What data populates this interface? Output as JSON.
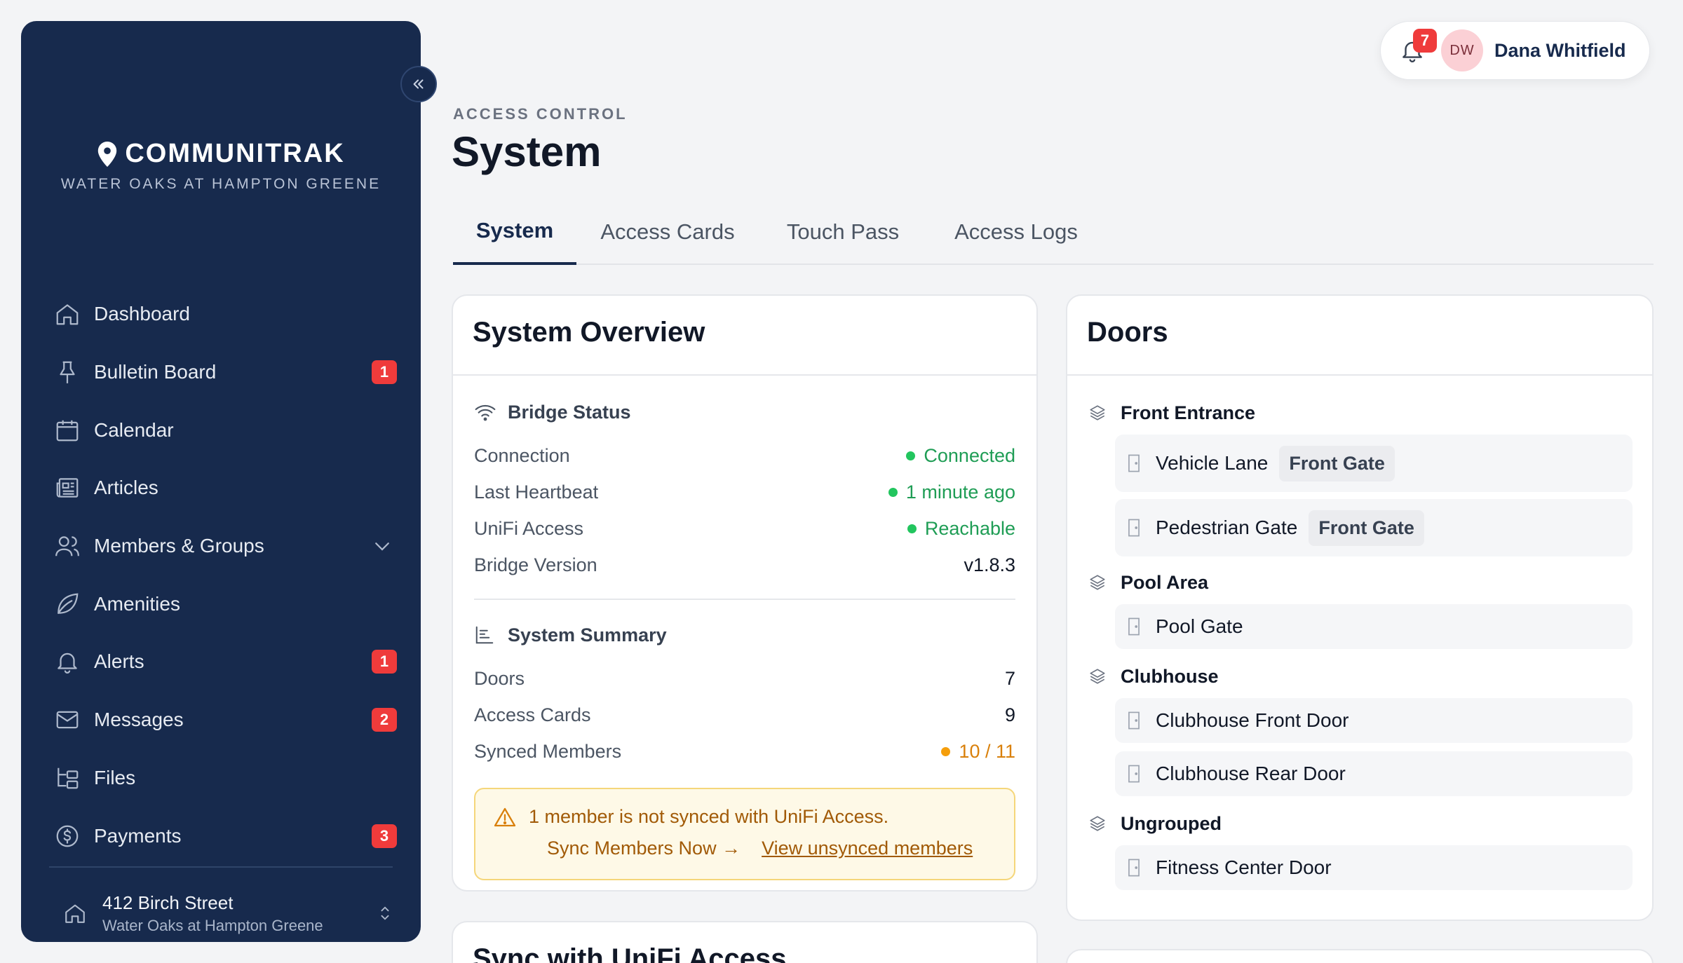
{
  "sidebar": {
    "brand_name": "COMMUNITRAK",
    "brand_subtitle": "WATER OAKS AT HAMPTON GREENE",
    "items": [
      {
        "label": "Dashboard",
        "icon": "home-icon"
      },
      {
        "label": "Bulletin Board",
        "icon": "pushpin-icon",
        "badge": "1"
      },
      {
        "label": "Calendar",
        "icon": "calendar-icon"
      },
      {
        "label": "Articles",
        "icon": "newspaper-icon"
      },
      {
        "label": "Members & Groups",
        "icon": "users-icon"
      },
      {
        "label": "Amenities",
        "icon": "leaf-icon"
      },
      {
        "label": "Alerts",
        "icon": "bell-icon",
        "badge": "1"
      },
      {
        "label": "Messages",
        "icon": "mail-icon",
        "badge": "2"
      },
      {
        "label": "Files",
        "icon": "folder-tree-icon"
      },
      {
        "label": "Payments",
        "icon": "dollar-circle-icon",
        "badge": "3"
      }
    ],
    "property_address": "412 Birch Street",
    "property_community": "Water Oaks at Hampton Greene"
  },
  "user": {
    "notification_count": "7",
    "initials": "DW",
    "name": "Dana Whitfield"
  },
  "header": {
    "eyebrow": "ACCESS CONTROL",
    "title": "System"
  },
  "tabs": [
    {
      "label": "System",
      "active": true
    },
    {
      "label": "Access Cards",
      "active": false
    },
    {
      "label": "Touch Pass",
      "active": false
    },
    {
      "label": "Access Logs",
      "active": false
    }
  ],
  "overview": {
    "title": "System Overview",
    "bridge_heading": "Bridge Status",
    "bridge": [
      {
        "label": "Connection",
        "value": "Connected"
      },
      {
        "label": "Last Heartbeat",
        "value": "1 minute ago"
      },
      {
        "label": "UniFi Access",
        "value": "Reachable"
      },
      {
        "label": "Bridge Version",
        "value": "v1.8.3"
      }
    ],
    "summary_heading": "System Summary",
    "summary": [
      {
        "label": "Doors",
        "value": "7"
      },
      {
        "label": "Access Cards",
        "value": "9"
      },
      {
        "label": "Synced Members",
        "value": "10 / 11"
      }
    ],
    "warning_text": "1 member is not synced with UniFi Access.",
    "sync_now_label": "Sync Members Now →",
    "view_unsynced_label": "View unsynced members"
  },
  "doors": {
    "title": "Doors",
    "groups": [
      {
        "name": "Front Entrance",
        "doors": [
          {
            "name": "Vehicle Lane",
            "tag": "Front Gate"
          },
          {
            "name": "Pedestrian Gate",
            "tag": "Front Gate"
          }
        ]
      },
      {
        "name": "Pool Area",
        "doors": [
          {
            "name": "Pool Gate",
            "tag": ""
          }
        ]
      },
      {
        "name": "Clubhouse",
        "doors": [
          {
            "name": "Clubhouse Front Door",
            "tag": ""
          },
          {
            "name": "Clubhouse Rear Door",
            "tag": ""
          }
        ]
      },
      {
        "name": "Ungrouped",
        "doors": [
          {
            "name": "Fitness Center Door",
            "tag": ""
          }
        ]
      }
    ]
  },
  "sync_card": {
    "title": "Sync with UniFi Access"
  },
  "colors": {
    "sidebar_bg": "#172a4d",
    "badge_red": "#ef3b3b",
    "status_green": "#1f9d55",
    "status_orange": "#d9800b"
  }
}
